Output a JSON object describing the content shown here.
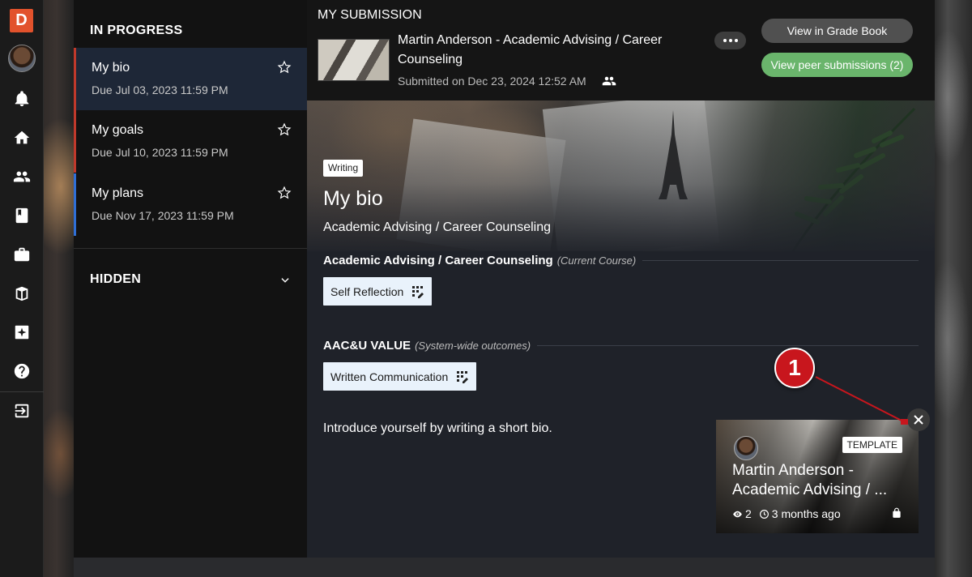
{
  "rail": {
    "logo": "D",
    "icons": [
      "bell-icon",
      "home-icon",
      "people-icon",
      "book-icon",
      "briefcase-icon",
      "library-icon",
      "sparkle-icon",
      "help-icon",
      "sign-in-icon"
    ]
  },
  "panel": {
    "in_progress_heading": "IN PROGRESS",
    "assignments": [
      {
        "title": "My bio",
        "due": "Due Jul 03, 2023 11:59 PM",
        "accent": "#c0392b",
        "active": true
      },
      {
        "title": "My goals",
        "due": "Due Jul 10, 2023 11:59 PM",
        "accent": "#c0392b",
        "active": false
      },
      {
        "title": "My plans",
        "due": "Due Nov 17, 2023 11:59 PM",
        "accent": "#2f6fd6",
        "active": false
      }
    ],
    "hidden_heading": "HIDDEN"
  },
  "submission": {
    "label": "MY SUBMISSION",
    "title": "Martin Anderson - Academic Advising / Career Counseling",
    "submitted": "Submitted on Dec 23, 2024 12:52 AM",
    "grade_book_button": "View in Grade Book",
    "peer_button": "View peer submissions (2)"
  },
  "hero": {
    "tag": "Writing",
    "title": "My bio",
    "course": "Academic Advising / Career Counseling"
  },
  "outcomes": {
    "course_section_title": "Academic Advising / Career Counseling",
    "course_section_note": "(Current Course)",
    "course_chip": "Self Reflection",
    "value_section_title": "AAC&U VALUE",
    "value_section_note": "(System-wide outcomes)",
    "value_chip": "Written Communication"
  },
  "prompt": "Introduce yourself by writing a short bio.",
  "template_card": {
    "tag": "TEMPLATE",
    "title_line1": "Martin Anderson -",
    "title_line2": "Academic Advising / ...",
    "views": "2",
    "age": "3 months ago"
  },
  "callout": {
    "number": "1",
    "color": "#c8161d"
  },
  "colors": {
    "accent_green": "#6ab56c",
    "active_row": "#1e2737",
    "brand": "#e2522c"
  }
}
